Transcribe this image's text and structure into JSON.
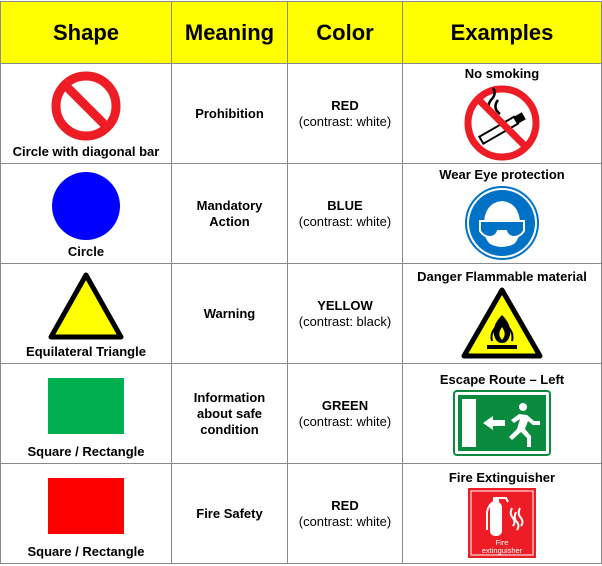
{
  "headers": {
    "shape": "Shape",
    "meaning": "Meaning",
    "color": "Color",
    "examples": "Examples"
  },
  "rows": [
    {
      "shape_label": "Circle with diagonal bar",
      "shape_icon": "prohibition-circle-icon",
      "meaning": "Prohibition",
      "color": "RED",
      "contrast": "(contrast: white)",
      "example_title": "No smoking",
      "example_icon": "no-smoking-sign-icon"
    },
    {
      "shape_label": "Circle",
      "shape_icon": "blue-circle-icon",
      "meaning_line1": "Mandatory",
      "meaning_line2": "Action",
      "color": "BLUE",
      "contrast": "(contrast: white)",
      "example_title": "Wear Eye protection",
      "example_icon": "eye-protection-sign-icon"
    },
    {
      "shape_label": "Equilateral Triangle",
      "shape_icon": "warning-triangle-icon",
      "meaning": "Warning",
      "color": "YELLOW",
      "contrast": "(contrast: black)",
      "example_title": "Danger Flammable material",
      "example_icon": "flammable-warning-sign-icon"
    },
    {
      "shape_label": "Square / Rectangle",
      "shape_icon": "green-square-icon",
      "meaning_line1": "Information",
      "meaning_line2": "about safe",
      "meaning_line3": "condition",
      "color": "GREEN",
      "contrast": "(contrast: white)",
      "example_title": "Escape Route – Left",
      "example_icon": "escape-route-sign-icon"
    },
    {
      "shape_label": "Square / Rectangle",
      "shape_icon": "red-square-icon",
      "meaning": "Fire Safety",
      "color": "RED",
      "contrast": "(contrast: white)",
      "example_title": "Fire Extinguisher",
      "example_icon": "fire-extinguisher-sign-icon",
      "example_sign_line1": "Fire",
      "example_sign_line2": "extinguisher"
    }
  ],
  "colors": {
    "header_bg": "#ffff00",
    "red": "#ee1c25",
    "blue": "#0000ff",
    "sign_blue": "#0072c6",
    "yellow": "#ffff00",
    "green": "#00b050",
    "sign_green": "#0a8a3c",
    "border": "#8a8a8a"
  }
}
